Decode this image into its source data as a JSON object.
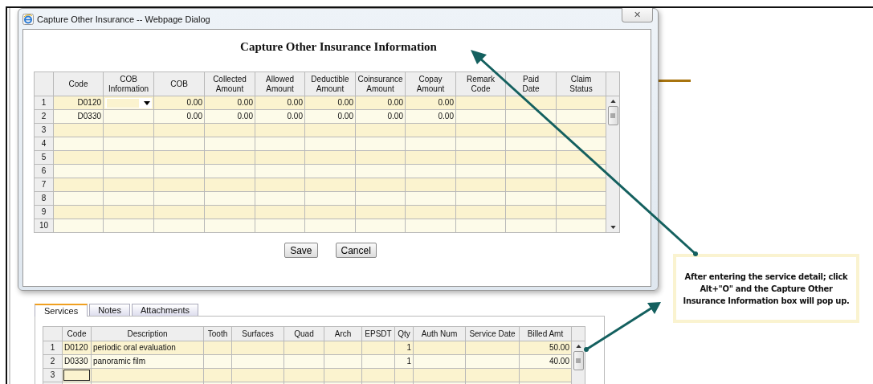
{
  "dialog": {
    "title": "Capture Other Insurance -- Webpage Dialog",
    "close": "✕",
    "heading": "Capture Other Insurance Information",
    "columns": [
      {
        "label": "Code"
      },
      {
        "label": "COB Information"
      },
      {
        "label": "COB"
      },
      {
        "label": "Collected Amount"
      },
      {
        "label": "Allowed Amount"
      },
      {
        "label": "Deductible Amount"
      },
      {
        "label": "Coinsurance Amount"
      },
      {
        "label": "Copay Amount"
      },
      {
        "label": "Remark Code"
      },
      {
        "label": "Paid Date"
      },
      {
        "label": "Claim Status"
      }
    ],
    "rows": [
      {
        "number": "1",
        "cells": [
          {
            "kind": "text",
            "text": "D0120"
          },
          {
            "kind": "dropdown"
          },
          {
            "kind": "text",
            "text": "0.00"
          },
          {
            "kind": "text",
            "text": "0.00"
          },
          {
            "kind": "text",
            "text": "0.00"
          },
          {
            "kind": "text",
            "text": "0.00"
          },
          {
            "kind": "text",
            "text": "0.00"
          },
          {
            "kind": "text",
            "text": "0.00"
          },
          {
            "kind": "blank"
          },
          {
            "kind": "blank"
          },
          {
            "kind": "blank"
          }
        ]
      },
      {
        "number": "2",
        "cells": [
          {
            "kind": "text",
            "text": "D0330"
          },
          {
            "kind": "blank"
          },
          {
            "kind": "text",
            "text": "0.00"
          },
          {
            "kind": "text",
            "text": "0.00"
          },
          {
            "kind": "text",
            "text": "0.00"
          },
          {
            "kind": "text",
            "text": "0.00"
          },
          {
            "kind": "text",
            "text": "0.00"
          },
          {
            "kind": "text",
            "text": "0.00"
          },
          {
            "kind": "blank"
          },
          {
            "kind": "blank"
          },
          {
            "kind": "blank"
          }
        ]
      },
      {
        "number": "3"
      },
      {
        "number": "4"
      },
      {
        "number": "5"
      },
      {
        "number": "6"
      },
      {
        "number": "7"
      },
      {
        "number": "8"
      },
      {
        "number": "9"
      },
      {
        "number": "10"
      }
    ],
    "buttons": [
      "Save",
      "Cancel"
    ]
  },
  "tabs": [
    {
      "label": "Services",
      "selected": true
    },
    {
      "label": "Notes",
      "selected": false
    },
    {
      "label": "Attachments",
      "selected": false
    }
  ],
  "services": {
    "columns": [
      "Code",
      "Description",
      "Tooth",
      "Surfaces",
      "Quad",
      "Arch",
      "EPSDT",
      "Qty",
      "Auth Num",
      "Service Date",
      "Billed Amt"
    ],
    "rows": [
      {
        "number": "1",
        "editing": false,
        "cells": [
          "D0120",
          "periodic oral evaluation",
          null,
          null,
          null,
          null,
          null,
          "1",
          null,
          null,
          "50.00"
        ]
      },
      {
        "number": "2",
        "editing": false,
        "cells": [
          "D0330",
          "panoramic film",
          null,
          null,
          null,
          null,
          null,
          "1",
          null,
          null,
          "40.00"
        ]
      },
      {
        "number": "3",
        "editing": true,
        "cells": [
          null,
          null,
          null,
          null,
          null,
          null,
          null,
          null,
          null,
          null,
          null
        ]
      }
    ]
  },
  "callout": {
    "text": "After entering the service detail; click Alt+\"O\" and the Capture Other Insurance Information box will pop up."
  }
}
